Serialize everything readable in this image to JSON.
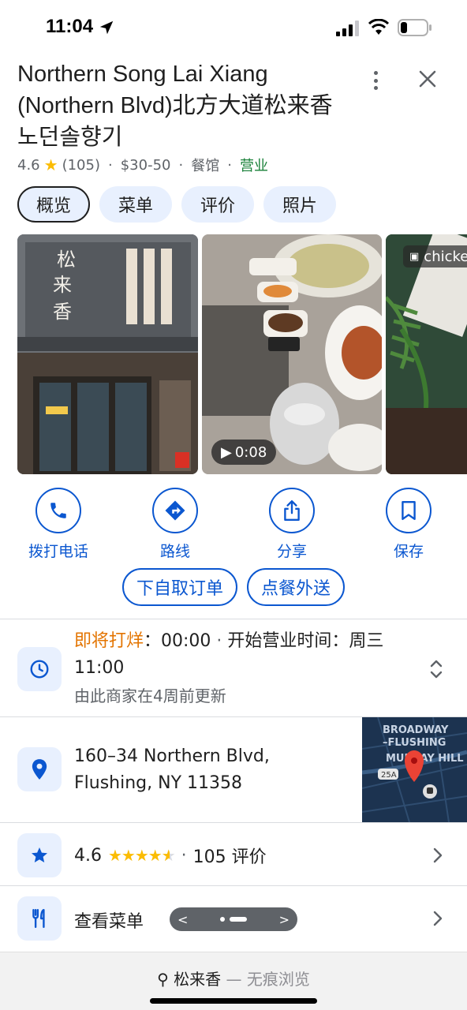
{
  "status_bar": {
    "time": "11:04"
  },
  "place": {
    "title": "Northern Song Lai Xiang (Northern Blvd)北方大道松来香 노던솔향기",
    "rating": "4.6",
    "review_count": "(105)",
    "price": "$30-50",
    "category": "餐馆",
    "open_status": "营业"
  },
  "tabs": [
    {
      "label": "概览",
      "active": true
    },
    {
      "label": "菜单"
    },
    {
      "label": "评价"
    },
    {
      "label": "照片"
    }
  ],
  "photos": {
    "video_duration": "0:08",
    "third_label": "chicke"
  },
  "actions": [
    {
      "label": "拨打电话",
      "icon": "phone-icon"
    },
    {
      "label": "路线",
      "icon": "directions-icon"
    },
    {
      "label": "分享",
      "icon": "share-icon"
    },
    {
      "label": "保存",
      "icon": "bookmark-icon"
    }
  ],
  "order": {
    "pickup": "下自取订单",
    "delivery": "点餐外送"
  },
  "hours": {
    "closing_soon": "即将打烊",
    "closing_time": "：00:00",
    "separator": " · ",
    "opens": "开始营业时间：周三 11:00",
    "updated": "由此商家在4周前更新"
  },
  "address": {
    "line1": "160–34 Northern Blvd,",
    "line2": "Flushing, NY 11358",
    "map_labels": [
      "BROADWAY",
      "–FLUSHING",
      "MURRAY HILL",
      "25A"
    ]
  },
  "reviews": {
    "rating": "4.6",
    "stars_value": 4.6,
    "count": "105 评价"
  },
  "menu": {
    "label": "查看菜单"
  },
  "browser": {
    "query": "松来香",
    "mode": "— 无痕浏览"
  },
  "colors": {
    "accent": "#0b57d0",
    "open": "#188038",
    "closing": "#e37400",
    "star": "#fbbc04"
  }
}
